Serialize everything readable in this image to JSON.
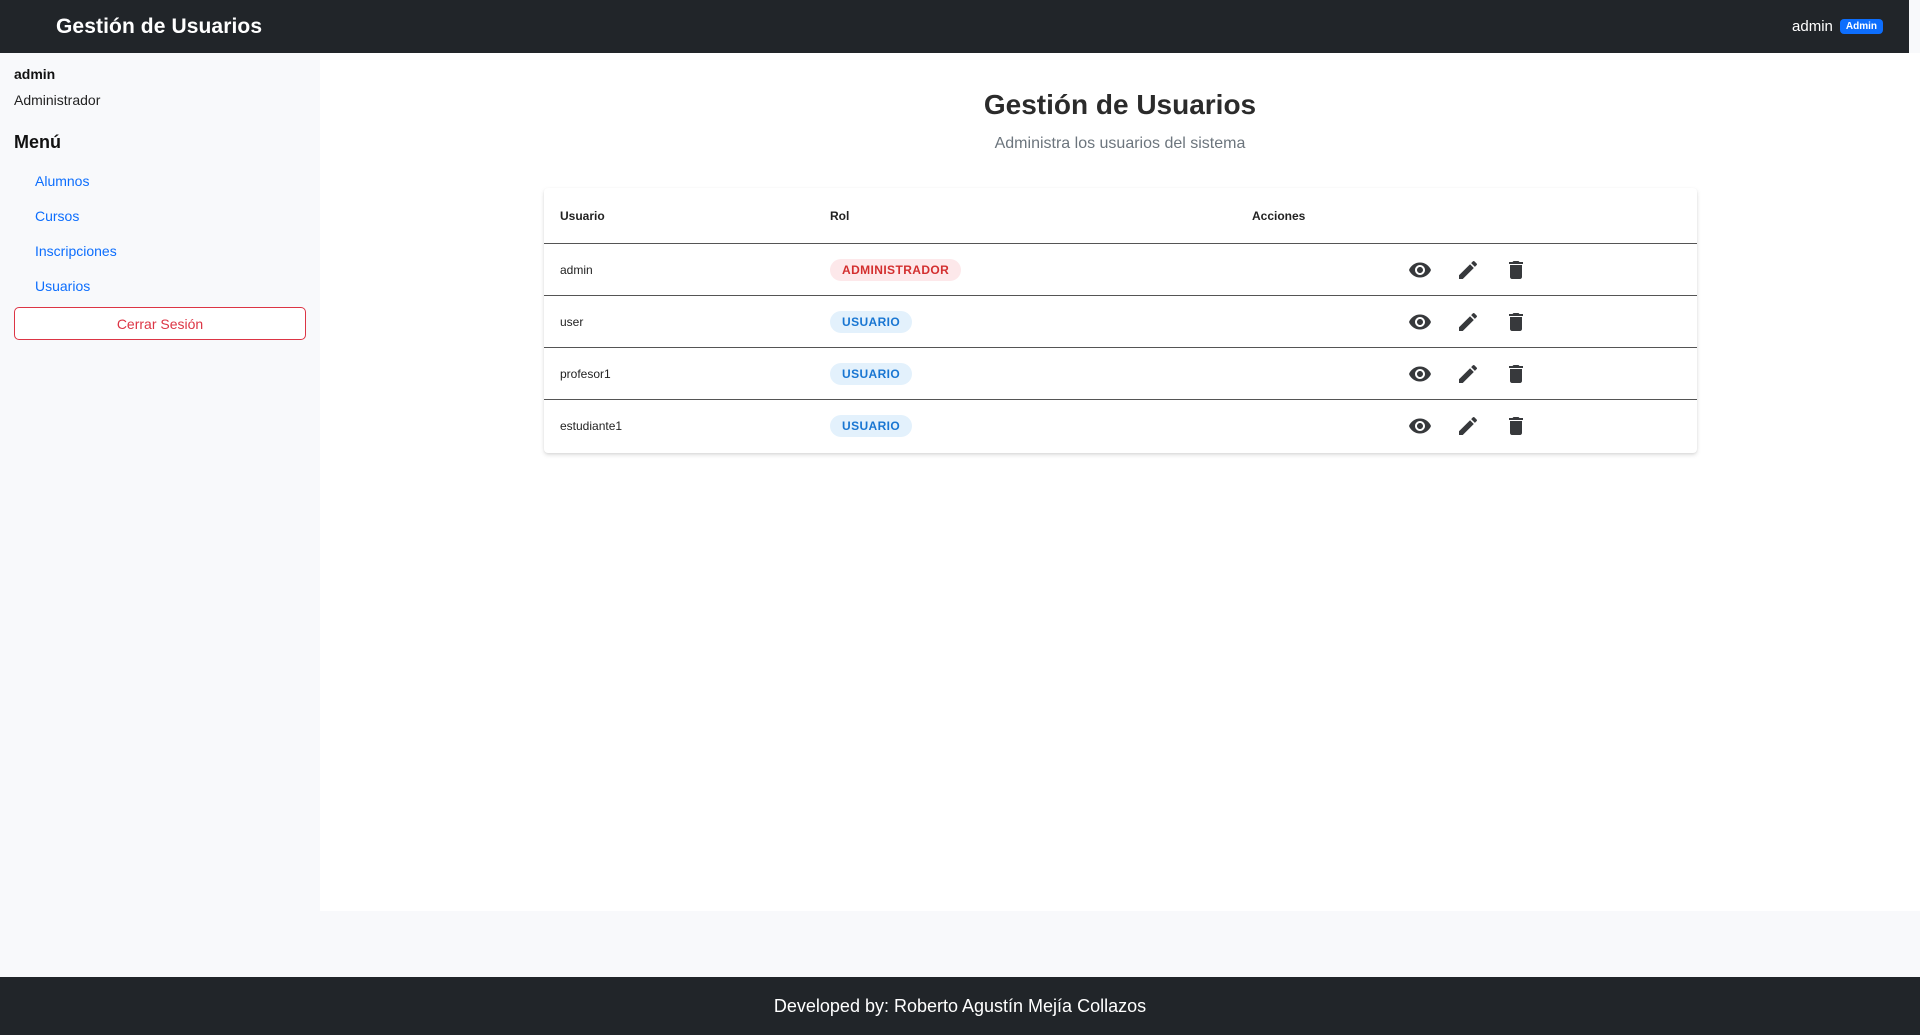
{
  "header": {
    "brand": "Gestión de Usuarios",
    "username": "admin",
    "role_badge": "Admin"
  },
  "sidebar": {
    "username": "admin",
    "role": "Administrador",
    "menu_title": "Menú",
    "items": [
      {
        "label": "Alumnos"
      },
      {
        "label": "Cursos"
      },
      {
        "label": "Inscripciones"
      },
      {
        "label": "Usuarios"
      }
    ],
    "logout_label": "Cerrar Sesión"
  },
  "main": {
    "title": "Gestión de Usuarios",
    "subtitle": "Administra los usuarios del sistema",
    "table": {
      "columns": [
        "Usuario",
        "Rol",
        "Acciones"
      ],
      "rows": [
        {
          "user": "admin",
          "role": "ADMINISTRADOR"
        },
        {
          "user": "user",
          "role": "USUARIO"
        },
        {
          "user": "profesor1",
          "role": "USUARIO"
        },
        {
          "user": "estudiante1",
          "role": "USUARIO"
        }
      ],
      "row_icons": [
        "eye-icon",
        "pencil-icon",
        "trash-icon"
      ]
    }
  },
  "footer": {
    "text": "Developed by: Roberto Agustín Mejía Collazos"
  },
  "colors": {
    "navbar": "#212529",
    "link": "#0d6efd",
    "danger": "#dc3545",
    "admin_pill_bg": "#fde8ea",
    "admin_pill_text": "#d32f2f",
    "user_pill_bg": "#e3f1fc",
    "user_pill_text": "#1976d2"
  }
}
